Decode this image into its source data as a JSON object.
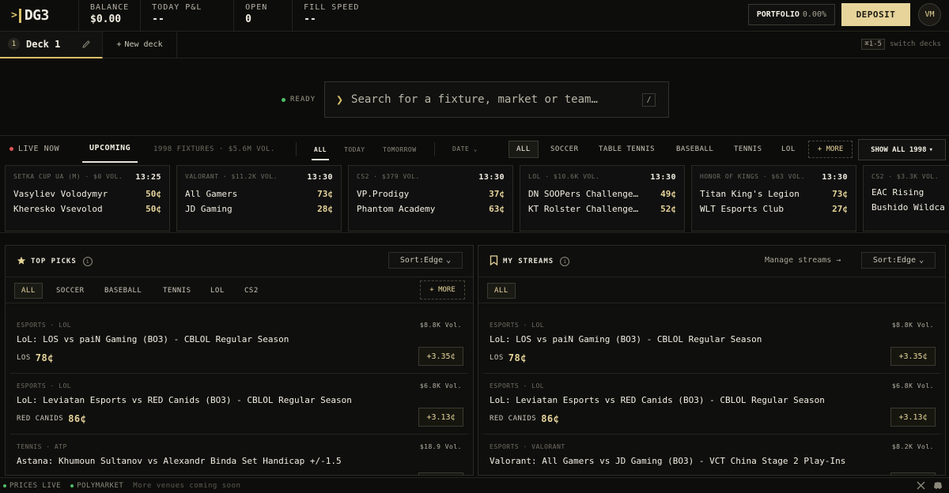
{
  "brand": {
    "prompt": ">",
    "name": "DG3"
  },
  "stats": [
    {
      "label": "BALANCE",
      "value": "$0.00"
    },
    {
      "label": "TODAY P&L",
      "value": "--"
    },
    {
      "label": "OPEN",
      "value": "0"
    },
    {
      "label": "FILL SPEED",
      "value": "--"
    }
  ],
  "header": {
    "portfolio_label": "PORTFOLIO",
    "portfolio_pct": "0.00%",
    "deposit_label": "DEPOSIT",
    "avatar_initials": "VM"
  },
  "decks": {
    "active_num": "1",
    "active_name": "Deck 1",
    "new_label": "New deck",
    "shortcut": "⌘1-5",
    "shortcut_label": "switch decks"
  },
  "search": {
    "status": "READY",
    "placeholder": "Search for a fixture, market or team…",
    "hotkey": "/"
  },
  "filters": {
    "live_label": "LIVE NOW",
    "upcoming_label": "UPCOMING",
    "fixtures_summary": "1998 FIXTURES · $5.6M VOL.",
    "time_tabs": [
      "ALL",
      "TODAY",
      "TOMORROW"
    ],
    "date_label": "DATE",
    "sports": [
      "ALL",
      "SOCCER",
      "TABLE TENNIS",
      "BASEBALL",
      "TENNIS",
      "LOL"
    ],
    "more_label": "+ MORE",
    "show_all_label": "SHOW ALL 1998"
  },
  "fixtures": [
    {
      "meta": "SETKA CUP UA (M) · $0 VOL.",
      "time": "13:25",
      "team1": "Vasyliev Volodymyr",
      "price1": "50¢",
      "team2": "Kheresko Vsevolod",
      "price2": "50¢"
    },
    {
      "meta": "VALORANT · $11.2K VOL.",
      "time": "13:30",
      "team1": "All Gamers",
      "price1": "73¢",
      "team2": "JD Gaming",
      "price2": "28¢"
    },
    {
      "meta": "CS2 · $379 VOL.",
      "time": "13:30",
      "team1": "VP.Prodigy",
      "price1": "37¢",
      "team2": "Phantom Academy",
      "price2": "63¢"
    },
    {
      "meta": "LOL · $10.6K VOL.",
      "time": "13:30",
      "team1": "DN SOOPers Challenge…",
      "price1": "49¢",
      "team2": "KT Rolster Challenge…",
      "price2": "52¢"
    },
    {
      "meta": "HONOR OF KINGS · $63 VOL.",
      "time": "13:30",
      "team1": "Titan King's Legion",
      "price1": "73¢",
      "team2": "WLT Esports Club",
      "price2": "27¢"
    },
    {
      "meta": "CS2 · $3.3K VOL.",
      "time": "",
      "team1": "EAC Rising",
      "price1": "",
      "team2": "Bushido Wildca",
      "price2": ""
    }
  ],
  "top_picks": {
    "title": "TOP PICKS",
    "sort_label": "Sort:Edge",
    "chips": [
      "ALL",
      "SOCCER",
      "BASEBALL",
      "TENNIS",
      "LOL",
      "CS2"
    ],
    "more_label": "+ MORE",
    "items": [
      {
        "meta": "ESPORTS · LOL",
        "vol": "$8.8K Vol.",
        "title": "LoL: LOS vs paiN Gaming (BO3) - CBLOL Regular Season",
        "side": "LOS",
        "price": "78¢",
        "edge": "+3.35¢"
      },
      {
        "meta": "ESPORTS · LOL",
        "vol": "$6.8K Vol.",
        "title": "LoL: Leviatan Esports vs RED Canids (BO3) - CBLOL Regular Season",
        "side": "RED CANIDS",
        "price": "86¢",
        "edge": "+3.13¢"
      },
      {
        "meta": "TENNIS · ATP",
        "vol": "$18.9 Vol.",
        "title": "Astana: Khumoun Sultanov vs Alexandr Binda Set Handicap +/-1.5",
        "side": "",
        "price": "",
        "edge": ""
      }
    ]
  },
  "my_streams": {
    "title": "MY STREAMS",
    "manage_label": "Manage streams →",
    "sort_label": "Sort:Edge",
    "chips": [
      "ALL"
    ],
    "items": [
      {
        "meta": "ESPORTS · LOL",
        "vol": "$8.8K Vol.",
        "title": "LoL: LOS vs paiN Gaming (BO3) - CBLOL Regular Season",
        "side": "LOS",
        "price": "78¢",
        "edge": "+3.35¢"
      },
      {
        "meta": "ESPORTS · LOL",
        "vol": "$6.8K Vol.",
        "title": "LoL: Leviatan Esports vs RED Canids (BO3) - CBLOL Regular Season",
        "side": "RED CANIDS",
        "price": "86¢",
        "edge": "+3.13¢"
      },
      {
        "meta": "ESPORTS · VALORANT",
        "vol": "$8.2K Vol.",
        "title": "Valorant: All Gamers vs JD Gaming (BO3) - VCT China Stage 2 Play-Ins",
        "side": "",
        "price": "",
        "edge": ""
      }
    ]
  },
  "footer": {
    "prices": "PRICES LIVE",
    "venue": "POLYMARKET",
    "soon": "More venues coming soon"
  },
  "colors": {
    "accent": "#e6d49a",
    "live": "#e05555",
    "ok": "#4fbf6a",
    "bg": "#0c0c0a"
  }
}
